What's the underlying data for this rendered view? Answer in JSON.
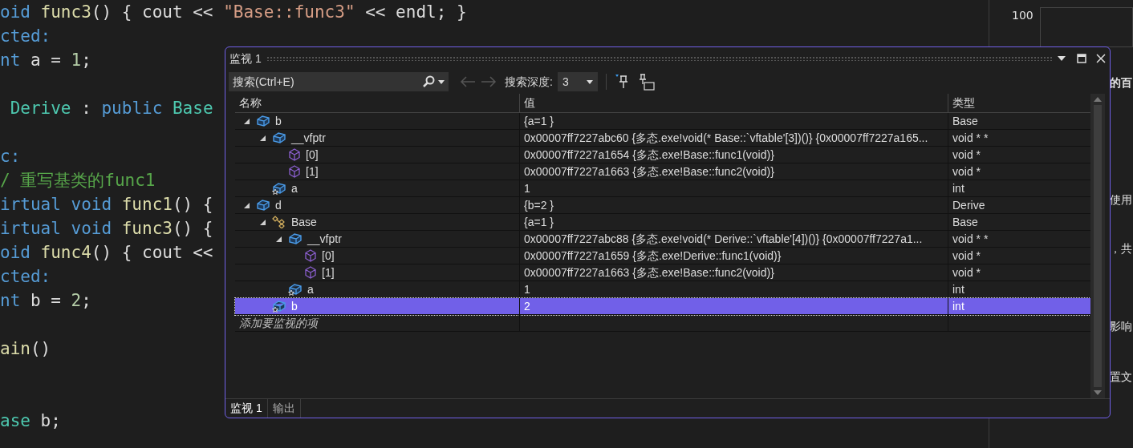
{
  "editor": {
    "lines": [
      {
        "segments": [
          {
            "text": "oid ",
            "kind": "keyword"
          },
          {
            "text": "func3",
            "kind": "function"
          },
          {
            "text": "() { cout << "
          },
          {
            "text": "\"Base::func3\"",
            "kind": "string"
          },
          {
            "text": " << endl; }"
          }
        ]
      },
      {
        "segments": [
          {
            "text": "cted:",
            "kind": "keyword"
          }
        ]
      },
      {
        "segments": [
          {
            "text": "nt",
            "kind": "keyword"
          },
          {
            "text": " a = "
          },
          {
            "text": "1",
            "kind": "number"
          },
          {
            "text": ";"
          }
        ]
      },
      {
        "blank": true
      },
      {
        "segments": [
          {
            "text": " Derive",
            "kind": "type"
          },
          {
            "text": " : "
          },
          {
            "text": "public ",
            "kind": "keyword"
          },
          {
            "text": "Base",
            "kind": "type"
          }
        ]
      },
      {
        "blank": true
      },
      {
        "segments": [
          {
            "text": "c:",
            "kind": "keyword"
          }
        ]
      },
      {
        "segments": [
          {
            "text": "/ 重写基类的func1",
            "kind": "comment"
          }
        ]
      },
      {
        "segments": [
          {
            "text": "irtual void ",
            "kind": "keyword"
          },
          {
            "text": "func1",
            "kind": "function"
          },
          {
            "text": "() {"
          }
        ]
      },
      {
        "segments": [
          {
            "text": "irtual void ",
            "kind": "keyword"
          },
          {
            "text": "func3",
            "kind": "function"
          },
          {
            "text": "() {"
          }
        ]
      },
      {
        "segments": [
          {
            "text": "oid ",
            "kind": "keyword"
          },
          {
            "text": "func4",
            "kind": "function"
          },
          {
            "text": "() { cout <<"
          }
        ]
      },
      {
        "segments": [
          {
            "text": "cted:",
            "kind": "keyword"
          }
        ]
      },
      {
        "segments": [
          {
            "text": "nt",
            "kind": "keyword"
          },
          {
            "text": " b = "
          },
          {
            "text": "2",
            "kind": "number"
          },
          {
            "text": ";"
          }
        ]
      },
      {
        "blank": true
      },
      {
        "segments": [
          {
            "text": "ain",
            "kind": "function"
          },
          {
            "text": "()"
          }
        ]
      },
      {
        "blank": true
      },
      {
        "blank": true
      },
      {
        "segments": [
          {
            "text": "ase",
            "kind": "type"
          },
          {
            "text": " b;"
          }
        ]
      }
    ]
  },
  "side_panel": {
    "axis_label": "100",
    "texts": [
      "的百",
      "使用",
      "，共",
      "影响",
      "置文"
    ]
  },
  "watch_window": {
    "title": "监视 1",
    "toolbar": {
      "search": {
        "placeholder": "搜索(Ctrl+E)"
      },
      "back_disabled": true,
      "forward_disabled": true,
      "depth_label": "搜索深度:",
      "depth_value": "3"
    },
    "columns": [
      "名称",
      "值",
      "类型"
    ],
    "rows": [
      {
        "name": "b",
        "value": "{a=1 }",
        "type": "Base",
        "kind": "object",
        "expanded": true,
        "selected": false,
        "children": [
          {
            "name": "__vfptr",
            "value": "0x00007ff7227abc60 {多态.exe!void(* Base::`vftable'[3])()} {0x00007ff7227a165...",
            "type": "void * *",
            "kind": "object",
            "expanded": true,
            "selected": false,
            "children": [
              {
                "name": "[0]",
                "value": "0x00007ff7227a1654 {多态.exe!Base::func1(void)}",
                "type": "void *",
                "kind": "element",
                "selected": false
              },
              {
                "name": "[1]",
                "value": "0x00007ff7227a1663 {多态.exe!Base::func2(void)}",
                "type": "void *",
                "kind": "element",
                "selected": false
              }
            ]
          },
          {
            "name": "a",
            "value": "1",
            "type": "int",
            "kind": "member",
            "selected": false
          }
        ]
      },
      {
        "name": "d",
        "value": "{b=2 }",
        "type": "Derive",
        "kind": "object",
        "expanded": true,
        "selected": false,
        "children": [
          {
            "name": "Base",
            "value": "{a=1 }",
            "type": "Base",
            "kind": "base",
            "expanded": true,
            "selected": false,
            "children": [
              {
                "name": "__vfptr",
                "value": "0x00007ff7227abc88 {多态.exe!void(* Derive::`vftable'[4])()} {0x00007ff7227a1...",
                "type": "void * *",
                "kind": "object",
                "expanded": true,
                "selected": false,
                "children": [
                  {
                    "name": "[0]",
                    "value": "0x00007ff7227a1659 {多态.exe!Derive::func1(void)}",
                    "type": "void *",
                    "kind": "element",
                    "selected": false
                  },
                  {
                    "name": "[1]",
                    "value": "0x00007ff7227a1663 {多态.exe!Base::func2(void)}",
                    "type": "void *",
                    "kind": "element",
                    "selected": false
                  }
                ]
              },
              {
                "name": "a",
                "value": "1",
                "type": "int",
                "kind": "member",
                "selected": false
              }
            ]
          },
          {
            "name": "b",
            "value": "2",
            "type": "int",
            "kind": "member",
            "selected": true
          }
        ]
      }
    ],
    "add_item_hint": "添加要监视的项",
    "tabs": [
      {
        "label": "监视 1",
        "selected": true
      },
      {
        "label": "输出",
        "selected": false
      }
    ]
  }
}
